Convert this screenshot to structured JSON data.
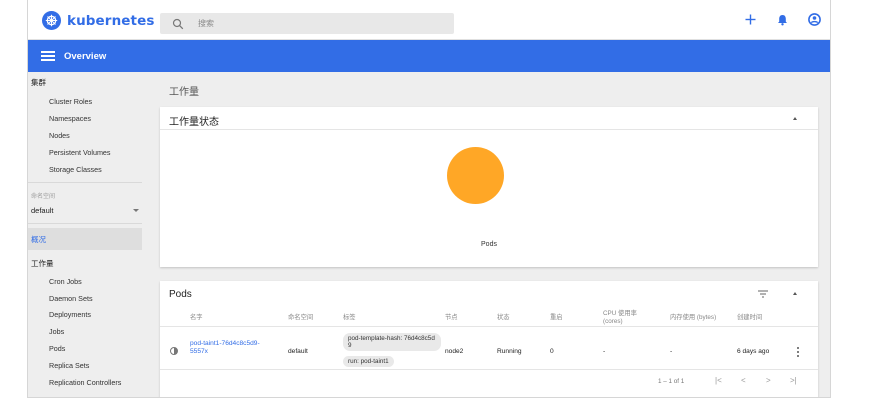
{
  "app": {
    "name": "kubernetes"
  },
  "search": {
    "placeholder": "搜索"
  },
  "header": {
    "title": "Overview"
  },
  "sidebar": {
    "cluster_heading": "集群",
    "cluster_items": [
      "Cluster Roles",
      "Namespaces",
      "Nodes",
      "Persistent Volumes",
      "Storage Classes"
    ],
    "namespace_label": "命名空间",
    "namespace_value": "default",
    "overview_label": "概况",
    "workloads_heading": "工作量",
    "workload_items": [
      "Cron Jobs",
      "Daemon Sets",
      "Deployments",
      "Jobs",
      "Pods",
      "Replica Sets",
      "Replication Controllers"
    ]
  },
  "main": {
    "page_title": "工作量",
    "status_card": {
      "title": "工作量状态",
      "pie_label": "Pods",
      "pie_color": "#ffa726"
    },
    "pods_card": {
      "title": "Pods",
      "columns": [
        "名字",
        "命名空间",
        "标签",
        "节点",
        "状态",
        "重启",
        "CPU 使用率 (cores)",
        "内存使用 (bytes)",
        "创建时间"
      ],
      "rows": [
        {
          "name": "pod-taint1-76d4c8c5d9-5557x",
          "namespace": "default",
          "labels": [
            "pod-template-hash: 76d4c8c5d9",
            "run: pod-taint1"
          ],
          "node": "node2",
          "status": "Running",
          "restarts": "0",
          "cpu": "-",
          "memory": "-",
          "created": "6 days ago"
        }
      ],
      "pagination": "1 – 1 of 1"
    }
  },
  "colors": {
    "accent": "#326de6",
    "background": "#eeeeee"
  }
}
